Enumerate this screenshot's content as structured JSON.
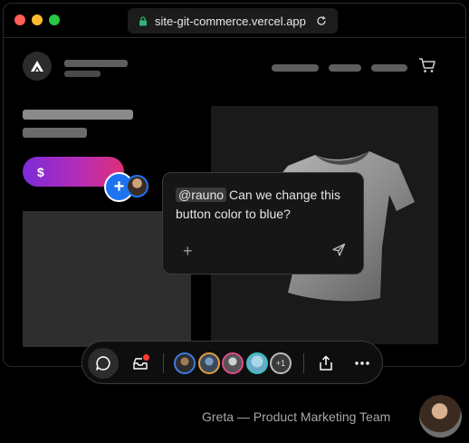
{
  "browser": {
    "url": "site-git-commerce.vercel.app",
    "lock_icon": "lock-icon",
    "reload_icon": "reload-icon"
  },
  "store": {
    "logo_icon": "triangle-logo-icon",
    "cart_icon": "cart-icon",
    "pay_button_label": "$",
    "cursor_icon": "plus-icon"
  },
  "comment": {
    "mention": "@rauno",
    "text": "Can we change this button color to blue?",
    "add_icon": "plus-icon",
    "send_icon": "send-icon"
  },
  "toolbar": {
    "comment_icon": "comment-icon",
    "inbox_icon": "inbox-icon",
    "more_count": "+1",
    "share_icon": "share-icon",
    "more_icon": "ellipsis-icon"
  },
  "caption": {
    "presenter": "Greta — Product Marketing Team"
  },
  "colors": {
    "accent": "#1d73f0",
    "gradient_start": "#7b2bd8",
    "gradient_end": "#e02e77",
    "badge": "#ff3b30"
  }
}
